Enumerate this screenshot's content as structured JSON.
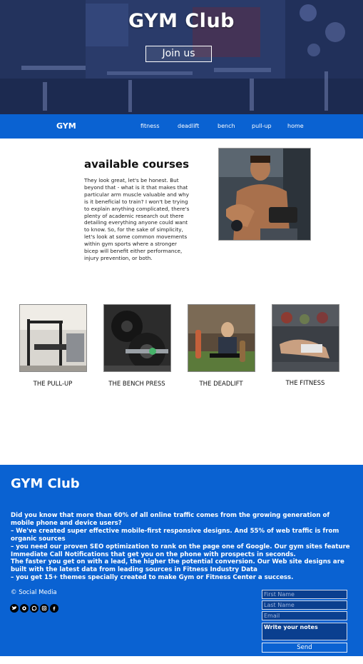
{
  "hero": {
    "title": "GYM Club",
    "join_label": "Join us"
  },
  "nav": {
    "brand": "GYM",
    "links": [
      "fitness",
      "deadlift",
      "bench",
      "pull-up",
      "home"
    ]
  },
  "courses": {
    "title": "available courses",
    "text": "They look great, let's be honest. But beyond that - what is it that makes that particular arm muscle valuable and why is it beneficial to train? I won't be trying to explain anything complicated, there's plenty of academic research out there detailing everything anyone could want to know. So, for the sake of simplicity, let's look at some common movements within gym sports where a stronger bicep will benefit either performance, injury prevention, or both."
  },
  "gallery": [
    {
      "label": "THE PULL-UP"
    },
    {
      "label": "THE BENCH PRESS"
    },
    {
      "label": "THE DEADLIFT"
    },
    {
      "label": "THE FITNESS"
    }
  ],
  "footer": {
    "title": "GYM Club",
    "paragraphs": [
      "Did you know that more than 60% of all online traffic comes from the growing generation of mobile phone and device users?",
      "– We've created super effective mobile-first responsive designs. And 55% of web traffic is from organic sources",
      "– you need our proven SEO optimization to rank on the page one of Google. Our gym sites feature Immediate Call Notifications that get you on the phone with prospects in seconds.",
      "The faster you get on with a lead, the higher the potential conversion. Our Web site designs are built with the latest data from leading sources in Fitness Industry Data",
      "– you get 15+ themes specially created to make Gym or Fitness Center a success."
    ],
    "copyright": "© Social Media",
    "social_icons": [
      "twitter-icon",
      "skype-icon",
      "whatsapp-icon",
      "instagram-icon",
      "facebook-icon"
    ],
    "form": {
      "first_name_placeholder": "First Name",
      "last_name_placeholder": "Last Name",
      "email_placeholder": "Email",
      "notes_placeholder": "Write your notes",
      "send_label": "Send"
    }
  },
  "colors": {
    "brand_blue": "#0a62d2",
    "hero_dark": "#1f2f5a"
  }
}
